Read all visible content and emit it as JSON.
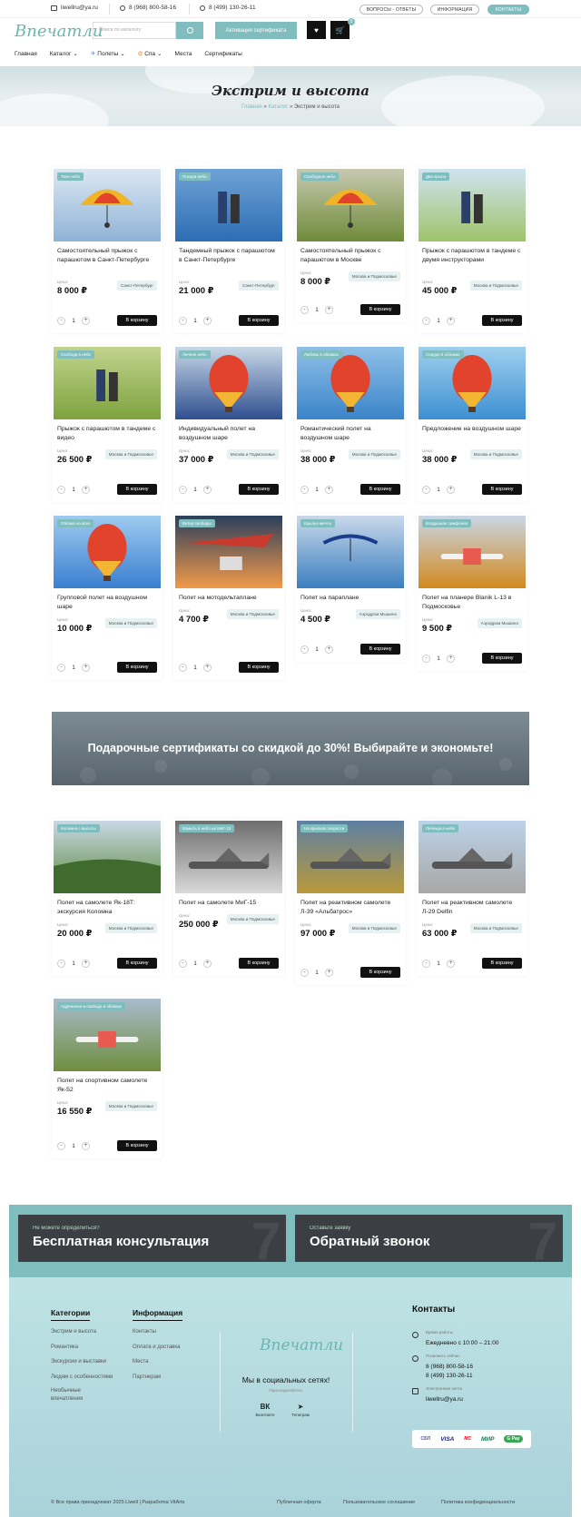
{
  "topbar": {
    "email": "liwellru@ya.ru",
    "phone1": "8 (968) 800-58-16",
    "phone2": "8 (499) 130-26-11",
    "links": [
      "ВОПРОСЫ - ОТВЕТЫ",
      "ИНФОРМАЦИЯ",
      "КОНТАКТЫ"
    ]
  },
  "header": {
    "logo": "Впечатли",
    "search_placeholder": "Поиск по каталогу",
    "activation_button": "Активация сертификата",
    "cart_count": "0"
  },
  "nav": [
    "Главная",
    "Каталог",
    "Полеты",
    "Спа",
    "Места",
    "Сертификаты"
  ],
  "hero": {
    "title": "Экстрим и высота",
    "crumbs": [
      "Главная",
      "Каталог",
      "Экстрим и высота"
    ]
  },
  "labels": {
    "price": "Цена:",
    "cart": "В корзину",
    "qty": "1",
    "minus": "-",
    "plus": "+"
  },
  "products": [
    {
      "tag": "Твое небо",
      "title": "Самостоятельный прыжок с парашютом в Санкт-Петербурге",
      "price": "8 000 ₽",
      "loc": "Санкт-Петербург"
    },
    {
      "tag": "Покори небо",
      "title": "Тандемный прыжок с парашютом в Санкт-Петербурге",
      "price": "21 000 ₽",
      "loc": "Санкт-Петербург"
    },
    {
      "tag": "Свободное небо",
      "title": "Самостоятельный прыжок с парашютом в Москве",
      "price": "8 000 ₽",
      "loc": "Москва и Подмосковье"
    },
    {
      "tag": "Два крыла",
      "title": "Прыжок с парашютом в тандеме с двумя инструкторами",
      "price": "45 000 ₽",
      "loc": "Москва и Подмосковье"
    },
    {
      "tag": "Свобода в небе",
      "title": "Прыжок с парашютом в тандеме с видео",
      "price": "26 500 ₽",
      "loc": "Москва и Подмосковье"
    },
    {
      "tag": "Личное небо",
      "title": "Индивидуальный полет на воздушном шаре",
      "price": "37 000 ₽",
      "loc": "Москва и Подмосковье"
    },
    {
      "tag": "Любовь в облаках",
      "title": "Романтический полет на воздушном шаре",
      "price": "38 000 ₽",
      "loc": "Москва и Подмосковье"
    },
    {
      "tag": "Сердце в облаках",
      "title": "Предложение на воздушном шаре",
      "price": "38 000 ₽",
      "loc": "Москва и Подмосковье"
    },
    {
      "tag": "Облака на всех",
      "title": "Групповой полет на воздушном шаре",
      "price": "10 000 ₽",
      "loc": "Москва и Подмосковье"
    },
    {
      "tag": "Ветер свободы",
      "title": "Полет на мотодельтаплане",
      "price": "4 700 ₽",
      "loc": "Москва и Подмосковье"
    },
    {
      "tag": "Крылья мечты",
      "title": "Полет на параплане",
      "price": "4 500 ₽",
      "loc": "Аэродром Мышино"
    },
    {
      "tag": "Воздушная симфония",
      "title": "Полет на планере Blanik L-13 в Подмосковье",
      "price": "9 500 ₽",
      "loc": "Аэродром Мышино"
    },
    {
      "tag": "Коломна с высоты",
      "title": "Полет на самолете Як-18Т: экскурсия Коломна",
      "price": "20 000 ₽",
      "loc": "Москва и Подмосковье"
    },
    {
      "tag": "Взмыть в небо на МиГ-15",
      "title": "Полет на самолете МиГ-15",
      "price": "250 000 ₽",
      "loc": "Москва и Подмосковье"
    },
    {
      "tag": "На крыльях скорости",
      "title": "Полет на реактивном самолете Л-39 «Альбатрос»",
      "price": "97 000 ₽",
      "loc": "Москва и Подмосковье"
    },
    {
      "tag": "Легенда в небе",
      "title": "Полет на реактивном самолете Л-29 Delfin",
      "price": "63 000 ₽",
      "loc": "Москва и Подмосковье"
    },
    {
      "tag": "Адреналин и свобода в облаках",
      "title": "Полет на спортивном самолете Як-52",
      "price": "16 550 ₽",
      "loc": "Москва и Подмосковье"
    }
  ],
  "promo": "Подарочные сертификаты со скидкой до 30%! Выбирайте и экономьте!",
  "cta": [
    {
      "small": "Не можете определиться?",
      "big": "Бесплатная консультация"
    },
    {
      "small": "Оставьте заявку",
      "big": "Обратный звонок"
    }
  ],
  "footer": {
    "categories_title": "Категории",
    "categories": [
      "Экстрим и высота",
      "Романтика",
      "Экскурсии и выставки",
      "Людям с особенностями",
      "Необычные впечатления"
    ],
    "info_title": "Информация",
    "info": [
      "Контакты",
      "Оплата и доставка",
      "Места",
      "Партнерам"
    ],
    "logo": "Впечатли",
    "social_title": "Мы в социальных сетях!",
    "subscribe": "Присоединяйтесь",
    "vk_label": "Вконтакте",
    "vk_icon": "ВК",
    "tg_label": "Телеграм",
    "tg_icon": "➤",
    "contacts_title": "Контакты",
    "hours_label": "Время работы",
    "hours": "Ежедневно с 10:00 – 21:00",
    "phone_label": "Позвонить сейчас",
    "phone1": "8 (968) 800-58-16",
    "phone2": "8 (499) 130-26-11",
    "email_label": "Электронная почта",
    "email": "liwellru@ya.ru",
    "payments": [
      "СБП",
      "VISA",
      "MC",
      "МИР",
      "G Pay"
    ],
    "copyright": "© Все права принадлежат 2025 Liwell | Разработка VitArts",
    "bottom_links": [
      "Публичная оферта",
      "Пользовательское соглашение",
      "Политика конфиденциальности"
    ]
  }
}
